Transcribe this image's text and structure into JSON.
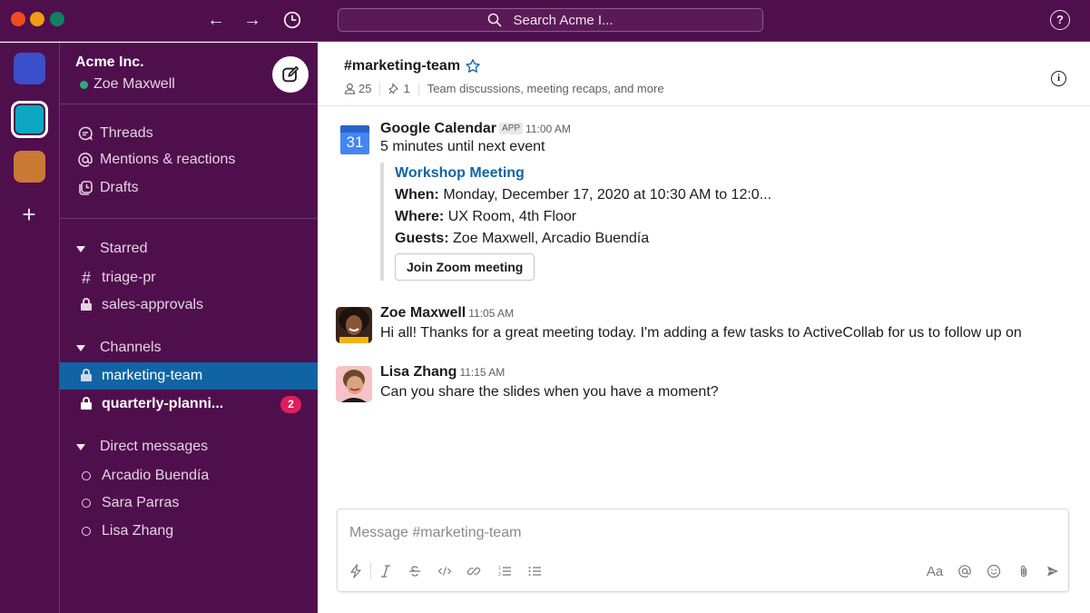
{
  "window": {
    "search_placeholder": "Search Acme I...",
    "colors": {
      "aubergine": "#4f0f4d",
      "active_channel": "#1164a3",
      "badge": "#e01e5a",
      "link": "#1264a3",
      "online": "#2bac76"
    }
  },
  "workspaces": [
    {
      "name": "workspace-1",
      "color": "#3b4fcc"
    },
    {
      "name": "workspace-2",
      "color": "#0da7c4",
      "active": true
    },
    {
      "name": "workspace-3",
      "color": "#c97a34"
    }
  ],
  "sidebar": {
    "workspace_name": "Acme Inc.",
    "user_name": "Zoe Maxwell",
    "nav": [
      {
        "label": "Threads",
        "icon": "threads-icon"
      },
      {
        "label": "Mentions & reactions",
        "icon": "mention-icon"
      },
      {
        "label": "Drafts",
        "icon": "drafts-icon"
      }
    ],
    "starred": {
      "label": "Starred",
      "items": [
        {
          "label": "triage-pr",
          "icon": "hash-icon"
        },
        {
          "label": "sales-approvals",
          "icon": "lock-icon"
        }
      ]
    },
    "channels": {
      "label": "Channels",
      "items": [
        {
          "label": "marketing-team",
          "icon": "lock-icon",
          "active": true
        },
        {
          "label": "quarterly-planni...",
          "icon": "lock-icon",
          "unread": true,
          "badge": "2"
        }
      ]
    },
    "direct_messages": {
      "label": "Direct messages",
      "items": [
        {
          "label": "Arcadio Buendía"
        },
        {
          "label": "Sara Parras"
        },
        {
          "label": "Lisa Zhang"
        }
      ]
    }
  },
  "channel": {
    "title": "#marketing-team",
    "members": "25",
    "pins": "1",
    "topic": "Team discussions, meeting recaps, and more"
  },
  "messages": [
    {
      "sender": "Google Calendar",
      "app_tag": "APP",
      "time": "11:00 AM",
      "text": "5 minutes until next event",
      "calendar_day": "31",
      "attachment": {
        "title": "Workshop Meeting",
        "when_label": "When:",
        "when": "Monday, December 17, 2020 at 10:30 AM to 12:0...",
        "where_label": "Where:",
        "where": "UX Room, 4th Floor",
        "guests_label": "Guests:",
        "guests": "Zoe Maxwell, Arcadio Buendía",
        "button": "Join Zoom meeting"
      }
    },
    {
      "sender": "Zoe Maxwell",
      "time": "11:05 AM",
      "text": "Hi all! Thanks for a great meeting today. I'm adding a few tasks to ActiveCollab for us to follow up on"
    },
    {
      "sender": "Lisa Zhang",
      "time": "11:15 AM",
      "text": "Can you share the slides when you have a moment?"
    }
  ],
  "composer": {
    "placeholder": "Message #marketing-team",
    "format_aa": "Aa"
  }
}
